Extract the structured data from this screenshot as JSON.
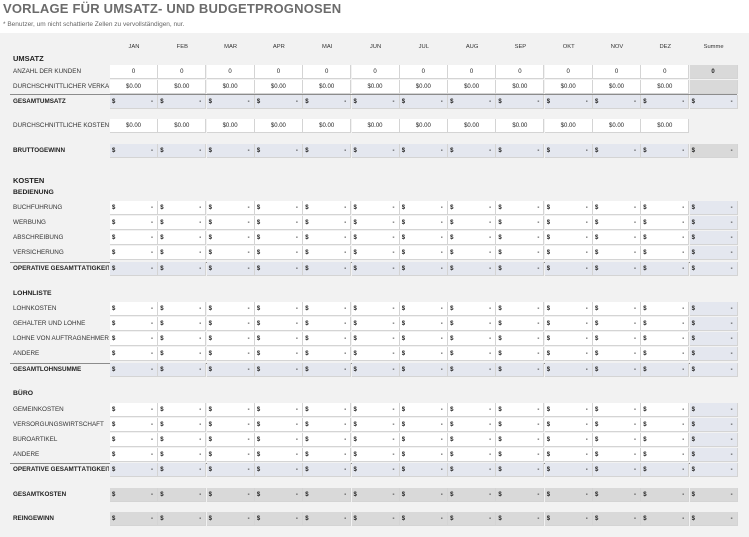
{
  "title": "VORLAGE FÜR UMSATZ- UND BUDGETPROGNOSEN",
  "subtitle": "* Benutzer, um nicht schattierte Zellen zu vervollständigen, nur.",
  "months": [
    "JAN",
    "FEB",
    "MAR",
    "APR",
    "MAI",
    "JUN",
    "JUL",
    "AUG",
    "SEP",
    "OKT",
    "NOV",
    "DEZ"
  ],
  "total_header": "Summe",
  "currency": "$",
  "dash": "-",
  "zero": "0",
  "money_zero": "$0.00",
  "umsatz": {
    "title": "UMSATZ",
    "kunden": "ANZAHL DER KUNDEN",
    "verkauf": "DURCHSCHNITTLICHER VERKAUF PRO KUNDE",
    "gesamt": "GESAMTUMSATZ",
    "kosten_pro": "DURCHSCHNITTLICHE KOSTEN PRO KUNDE",
    "brutto": "BRUTTOGEWINN"
  },
  "kosten": {
    "title": "KOSTEN",
    "bedienung": {
      "title": "BEDIENUNG",
      "rows": [
        "BUCHFÜHRUNG",
        "WERBUNG",
        "ABSCHREIBUNG",
        "VERSICHERUNG"
      ],
      "total": "OPERATIVE GESAMTTÄTIGKEIT"
    },
    "lohnliste": {
      "title": "LOHNLISTE",
      "rows": [
        "LOHNKOSTEN",
        "GEHÄLTER UND LÖHNE",
        "LÖHNE VON AUFTRAGNEHMERN",
        "ANDERE"
      ],
      "total": "GESAMTLOHNSUMME"
    },
    "buero": {
      "title": "BÜRO",
      "rows": [
        "GEMEINKOSTEN",
        "VERSORGUNGSWIRTSCHAFT",
        "BÜROARTIKEL",
        "ANDERE"
      ],
      "total": "OPERATIVE GESAMTTÄTIGKEIT"
    },
    "gesamt": "GESAMTKOSTEN",
    "rein": "REINGEWINN"
  },
  "colors": {
    "shaded_blue": "#e4e7ef",
    "shaded_gray": "#d9d9d9",
    "sheet_bg": "#f2f2f2"
  }
}
